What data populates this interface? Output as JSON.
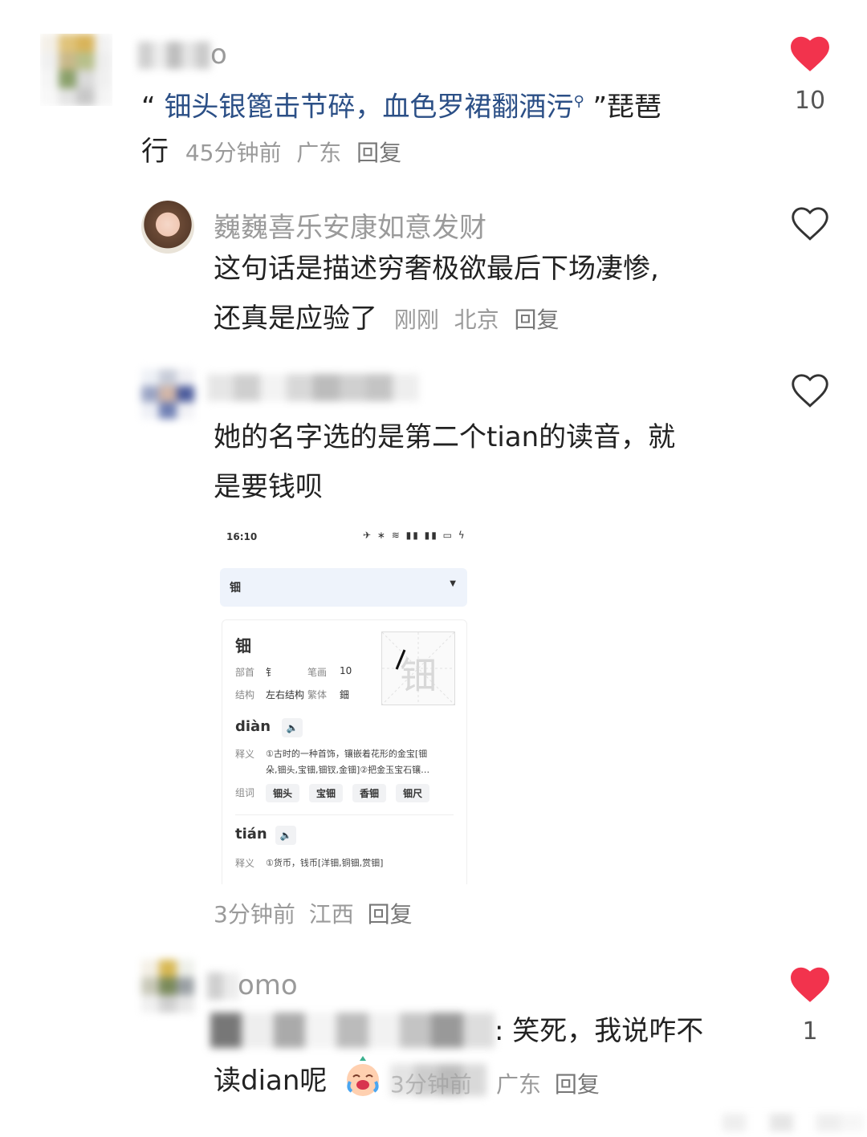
{
  "comments": [
    {
      "username": "o",
      "text_open": "“",
      "quote": "钿头银篦击节碎，血色罗裙翻酒污",
      "text_close": "”琵琶",
      "text_line2": "行",
      "time": "45分钟前",
      "location": "广东",
      "reply": "回复",
      "likes": "10",
      "liked": true
    },
    {
      "username": "巍巍喜乐安康如意发财",
      "text_line1": "这句话是描述穷奢极欲最后下场凄惨,",
      "text_line2": "还真是应验了",
      "time": "刚刚",
      "location": "北京",
      "reply": "回复",
      "liked": false
    },
    {
      "username": "",
      "text_line1": "她的名字选的是第二个tian的读音，就",
      "text_line2": "是要钱呗",
      "time": "3分钟前",
      "location": "江西",
      "reply": "回复",
      "liked": false
    },
    {
      "username": "omo",
      "text_line1_tail": ": 笑死，我说咋不",
      "text_line2": "读dian呢",
      "time_frag": "3分钟前",
      "location": "广东",
      "reply": "回复",
      "likes": "1",
      "liked": true
    }
  ],
  "embedded_screenshot": {
    "status_time": "16:10",
    "search_value": "钿",
    "char": "钿",
    "radical_label": "部首",
    "radical": "钅",
    "strokes_label": "笔画",
    "strokes": "10",
    "structure_label": "结构",
    "structure": "左右结构",
    "traditional_label": "繁体",
    "traditional": "鈿",
    "pinyin1": "diàn",
    "meaning_label": "释义",
    "meaning1_line1": "①古时的一种首饰，镶嵌着花形的金宝[钿",
    "meaning1_line2": "朵,钿头,宝钿,钿钗,金钿]②把金玉宝石镶…",
    "words_label": "组词",
    "words1": [
      "钿头",
      "宝钿",
      "香钿",
      "钿尺"
    ],
    "pinyin2": "tián",
    "meaning2": "①货币，钱币[洋钿,铜钿,赏钿]"
  },
  "colors": {
    "like_red": "#f2334d",
    "link_blue": "#2b4f86",
    "meta_gray": "#9a9a9a"
  }
}
